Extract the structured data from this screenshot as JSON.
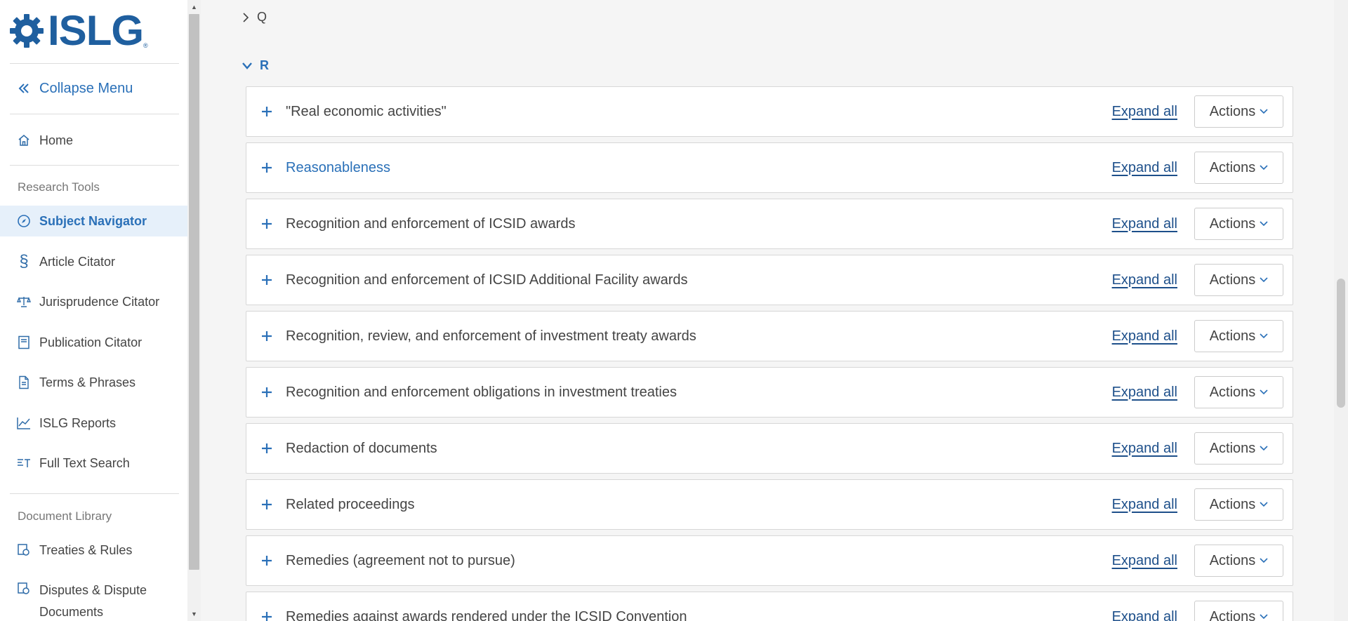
{
  "brand": {
    "name": "ISLG",
    "reg_mark": "®"
  },
  "sidebar": {
    "collapse_label": "Collapse Menu",
    "home_label": "Home",
    "research_tools_title": "Research Tools",
    "research_tools": [
      {
        "label": "Subject Navigator",
        "icon": "compass-icon",
        "active": true
      },
      {
        "label": "Article Citator",
        "icon": "section-icon"
      },
      {
        "label": "Jurisprudence Citator",
        "icon": "scales-icon"
      },
      {
        "label": "Publication Citator",
        "icon": "book-icon"
      },
      {
        "label": "Terms & Phrases",
        "icon": "document-icon"
      },
      {
        "label": "ISLG Reports",
        "icon": "chart-icon"
      },
      {
        "label": "Full Text Search",
        "icon": "text-search-icon"
      }
    ],
    "document_library_title": "Document Library",
    "document_library": [
      {
        "label": "Treaties & Rules",
        "icon": "treaty-icon"
      },
      {
        "label": "Disputes & Dispute Documents",
        "icon": "dispute-icon"
      }
    ]
  },
  "main": {
    "letters": {
      "q": "Q",
      "r": "R"
    },
    "expand_all_label": "Expand all",
    "actions_label": "Actions",
    "subjects": [
      {
        "title": "\"Real economic activities\"",
        "link": false
      },
      {
        "title": "Reasonableness",
        "link": true
      },
      {
        "title": "Recognition and enforcement of ICSID awards",
        "link": false
      },
      {
        "title": "Recognition and enforcement of ICSID Additional Facility awards",
        "link": false
      },
      {
        "title": "Recognition, review, and enforcement of investment treaty awards",
        "link": false
      },
      {
        "title": "Recognition and enforcement obligations in investment treaties",
        "link": false
      },
      {
        "title": "Redaction of documents",
        "link": false
      },
      {
        "title": "Related proceedings",
        "link": false
      },
      {
        "title": "Remedies (agreement not to pursue)",
        "link": false
      },
      {
        "title": "Remedies against awards rendered under the ICSID Convention",
        "link": false
      }
    ]
  },
  "colors": {
    "accent": "#2a70b8",
    "link_dark": "#1d4f8a",
    "active_bg": "#e6f0fa"
  }
}
